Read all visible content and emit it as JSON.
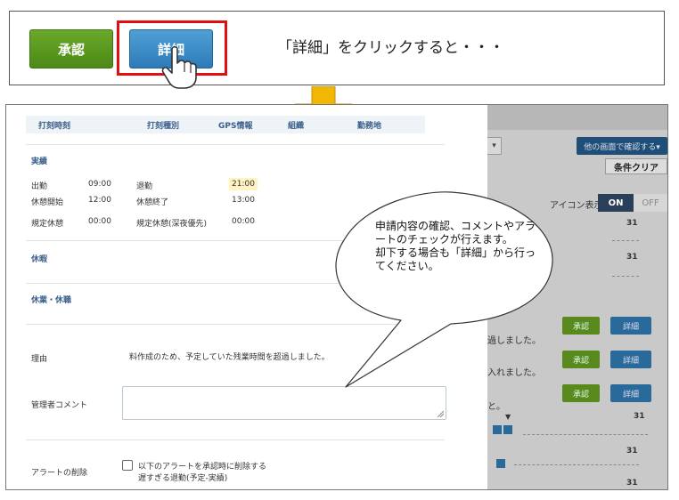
{
  "top": {
    "approve_label": "承認",
    "detail_label": "詳細",
    "caption": "「詳細」をクリックすると・・・"
  },
  "detail": {
    "header": [
      "打刻時刻",
      "打刻種別",
      "GPS情報",
      "組織",
      "勤務地"
    ],
    "actual_title": "実績",
    "rows": [
      {
        "label_a": "出勤",
        "value_a": "09:00",
        "label_b": "退勤",
        "value_b": "21:00"
      },
      {
        "label_a": "休憩開始",
        "value_a": "12:00",
        "label_b": "休憩終了",
        "value_b": "13:00"
      },
      {
        "label_a": "規定休憩",
        "value_a": "00:00",
        "label_b": "規定休憩(深夜優先)",
        "value_b": "00:00"
      }
    ],
    "holiday_title": "休暇",
    "leave_title": "休業・休職",
    "reason_label": "理由",
    "reason_value": "料作成のため、予定していた残業時間を超過しました。",
    "comment_label": "管理者コメント",
    "comment_value": "",
    "alert_label": "アラートの削除",
    "alert_check_line1": "以下のアラートを承認時に削除する",
    "alert_check_line2": "遅すぎる退勤(予定-実績)"
  },
  "background": {
    "confirm_button": "他の画面で確認する▾",
    "clear_button": "条件クリア",
    "icon_toggle_label": "アイコン表示",
    "on_label": "ON",
    "off_label": "OFF",
    "day_number": "31",
    "row_texts": [
      "過しました。",
      "入れました。",
      "と。"
    ],
    "approve_label": "承認",
    "detail_label": "詳細",
    "dropdown_arrow": "▼"
  },
  "bubble": {
    "text": "申請内容の確認、コメントやアラートのチェックが行えます。\n却下する場合も「詳細」から行ってください。"
  },
  "colors": {
    "approve_green": "#5a9a20",
    "detail_blue": "#2c7bb8",
    "highlight_red": "#e01010",
    "arrow_yellow": "#f2b705",
    "section_blue": "#3b5f8a"
  }
}
